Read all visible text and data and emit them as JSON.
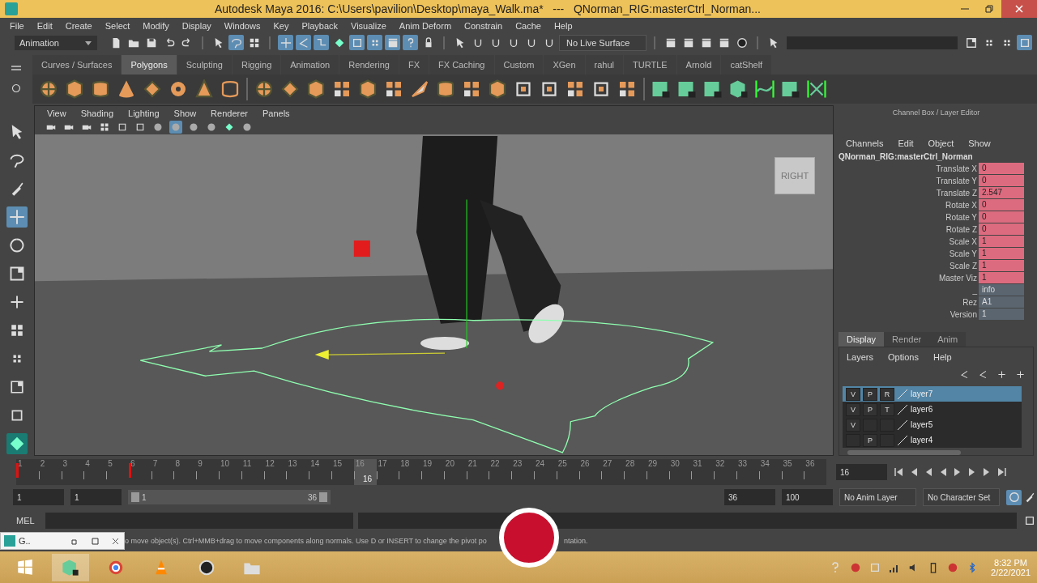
{
  "window": {
    "title": "Autodesk Maya 2016: C:\\Users\\pavilion\\Desktop\\maya_Walk.ma*   ---   QNorman_RIG:masterCtrl_Norman..."
  },
  "menu_bar": [
    "File",
    "Edit",
    "Create",
    "Select",
    "Modify",
    "Display",
    "Windows",
    "Key",
    "Playback",
    "Visualize",
    "Anim Deform",
    "Constrain",
    "Cache",
    "Help"
  ],
  "status_line": {
    "mode": "Animation",
    "live_surface": "No Live Surface",
    "tools": [
      {
        "kind": "page",
        "on": false
      },
      {
        "kind": "folder",
        "on": false
      },
      {
        "kind": "disk",
        "on": false
      },
      {
        "kind": "undo",
        "on": false
      },
      {
        "kind": "redo",
        "on": false
      },
      {
        "kind": "cursor",
        "on": false
      },
      {
        "kind": "lasso",
        "on": true
      },
      {
        "kind": "grid",
        "on": false
      },
      {
        "kind": "move",
        "on": true
      },
      {
        "kind": "angle",
        "on": true
      },
      {
        "kind": "curve",
        "on": true
      },
      {
        "kind": "diamond",
        "on": false
      },
      {
        "kind": "frame",
        "on": true
      },
      {
        "kind": "dots",
        "on": true
      },
      {
        "kind": "clapper",
        "on": true
      },
      {
        "kind": "help",
        "on": true
      },
      {
        "kind": "lock",
        "on": false
      },
      {
        "kind": "cursor",
        "on": false
      },
      {
        "kind": "magnet",
        "on": false
      },
      {
        "kind": "magnet",
        "on": false
      },
      {
        "kind": "magnet",
        "on": false
      },
      {
        "kind": "magnet",
        "on": false
      },
      {
        "kind": "magnet",
        "on": false
      }
    ]
  },
  "shelf_tabs": [
    {
      "label": "Curves / Surfaces",
      "selected": false
    },
    {
      "label": "Polygons",
      "selected": true
    },
    {
      "label": "Sculpting",
      "selected": false
    },
    {
      "label": "Rigging",
      "selected": false
    },
    {
      "label": "Animation",
      "selected": false
    },
    {
      "label": "Rendering",
      "selected": false
    },
    {
      "label": "FX",
      "selected": false
    },
    {
      "label": "FX Caching",
      "selected": false
    },
    {
      "label": "Custom",
      "selected": false
    },
    {
      "label": "XGen",
      "selected": false
    },
    {
      "label": "rahul",
      "selected": false
    },
    {
      "label": "TURTLE",
      "selected": false
    },
    {
      "label": "Arnold",
      "selected": false
    },
    {
      "label": "catShelf",
      "selected": false
    }
  ],
  "toolbox": [
    {
      "kind": "cursor",
      "selected": false
    },
    {
      "kind": "lasso",
      "selected": false
    },
    {
      "kind": "paint",
      "selected": false
    },
    {
      "kind": "move",
      "selected": true
    },
    {
      "kind": "rotate",
      "selected": false
    },
    {
      "kind": "scale",
      "selected": false
    },
    {
      "kind": "plus",
      "selected": false
    }
  ],
  "viewport": {
    "menus": [
      "View",
      "Shading",
      "Lighting",
      "Show",
      "Renderer",
      "Panels"
    ],
    "view_cube": "RIGHT",
    "tools": [
      {
        "kind": "camera",
        "on": false
      },
      {
        "kind": "camera",
        "on": false
      },
      {
        "kind": "camera",
        "on": false
      },
      {
        "kind": "grid",
        "on": false
      },
      {
        "kind": "frame",
        "on": false
      },
      {
        "kind": "frame",
        "on": false
      },
      {
        "kind": "sphere",
        "on": false
      },
      {
        "kind": "sphere",
        "on": true
      },
      {
        "kind": "sphere",
        "on": false
      },
      {
        "kind": "sphere",
        "on": false
      },
      {
        "kind": "diamond",
        "on": false
      },
      {
        "kind": "sphere",
        "on": false
      }
    ]
  },
  "channel_box": {
    "title": "Channel Box / Layer Editor",
    "menus": [
      "Channels",
      "Edit",
      "Object",
      "Show"
    ],
    "object": "QNorman_RIG:masterCtrl_Norman",
    "channels": [
      {
        "name": "Translate X",
        "value": "0",
        "kind": "keyed"
      },
      {
        "name": "Translate Y",
        "value": "0",
        "kind": "keyed"
      },
      {
        "name": "Translate Z",
        "value": "2.547",
        "kind": "keyed"
      },
      {
        "name": "Rotate X",
        "value": "0",
        "kind": "keyed"
      },
      {
        "name": "Rotate Y",
        "value": "0",
        "kind": "keyed"
      },
      {
        "name": "Rotate Z",
        "value": "0",
        "kind": "keyed"
      },
      {
        "name": "Scale X",
        "value": "1",
        "kind": "keyed"
      },
      {
        "name": "Scale Y",
        "value": "1",
        "kind": "keyed"
      },
      {
        "name": "Scale Z",
        "value": "1",
        "kind": "keyed"
      },
      {
        "name": "Master Viz",
        "value": "1",
        "kind": "keyed"
      },
      {
        "name": "_",
        "value": "info",
        "kind": "plain"
      },
      {
        "name": "Rez",
        "value": "A1",
        "kind": "plain"
      },
      {
        "name": "Version",
        "value": "1",
        "kind": "plain"
      }
    ]
  },
  "layer_editor": {
    "tabs": [
      {
        "label": "Display",
        "selected": true
      },
      {
        "label": "Render",
        "selected": false
      },
      {
        "label": "Anim",
        "selected": false
      }
    ],
    "menus": [
      "Layers",
      "Options",
      "Help"
    ],
    "layers": [
      {
        "name": "layer7",
        "selected": true,
        "v": "V",
        "p": "P",
        "t": "R"
      },
      {
        "name": "layer6",
        "selected": false,
        "v": "V",
        "p": "P",
        "t": "T"
      },
      {
        "name": "layer5",
        "selected": false,
        "v": "V"
      },
      {
        "name": "layer4",
        "selected": false,
        "p": "P"
      }
    ]
  },
  "timeline": {
    "current": "16",
    "frames": [
      {
        "label": "1",
        "key": true
      },
      {
        "label": "2",
        "key": false
      },
      {
        "label": "3",
        "key": false
      },
      {
        "label": "4",
        "key": false
      },
      {
        "label": "5",
        "key": false
      },
      {
        "label": "6",
        "key": true
      },
      {
        "label": "7",
        "key": false
      },
      {
        "label": "8",
        "key": false
      },
      {
        "label": "9",
        "key": false
      },
      {
        "label": "10",
        "key": false
      },
      {
        "label": "11",
        "key": false
      },
      {
        "label": "12",
        "key": false
      },
      {
        "label": "13",
        "key": false
      },
      {
        "label": "14",
        "key": false
      },
      {
        "label": "15",
        "key": false
      },
      {
        "label": "16",
        "key": false
      },
      {
        "label": "17",
        "key": false
      },
      {
        "label": "18",
        "key": false
      },
      {
        "label": "19",
        "key": false
      },
      {
        "label": "20",
        "key": false
      },
      {
        "label": "21",
        "key": false
      },
      {
        "label": "22",
        "key": false
      },
      {
        "label": "23",
        "key": false
      },
      {
        "label": "24",
        "key": false
      },
      {
        "label": "25",
        "key": false
      },
      {
        "label": "26",
        "key": false
      },
      {
        "label": "27",
        "key": false
      },
      {
        "label": "28",
        "key": false
      },
      {
        "label": "29",
        "key": false
      },
      {
        "label": "30",
        "key": false
      },
      {
        "label": "31",
        "key": false
      },
      {
        "label": "32",
        "key": false
      },
      {
        "label": "33",
        "key": false
      },
      {
        "label": "34",
        "key": false
      },
      {
        "label": "35",
        "key": false
      },
      {
        "label": "36",
        "key": false
      }
    ],
    "current_field": "16"
  },
  "range": {
    "level": 1,
    "start": "1",
    "playback_start": "1",
    "slider_start": "1",
    "slider_end": "36",
    "playback_end": "36",
    "end": "100",
    "anim_layer": "No Anim Layer",
    "character_set": "No Character Set"
  },
  "command_line": {
    "language": "MEL"
  },
  "help_line": [
    "o move object(s). Ctrl+MMB+drag to move components along normals. Use D or INSERT to change the pivot po",
    "ntation."
  ],
  "mini_window": {
    "title": "G.."
  },
  "taskbar": {
    "time": "8:32 PM",
    "date": "2/22/2021"
  }
}
